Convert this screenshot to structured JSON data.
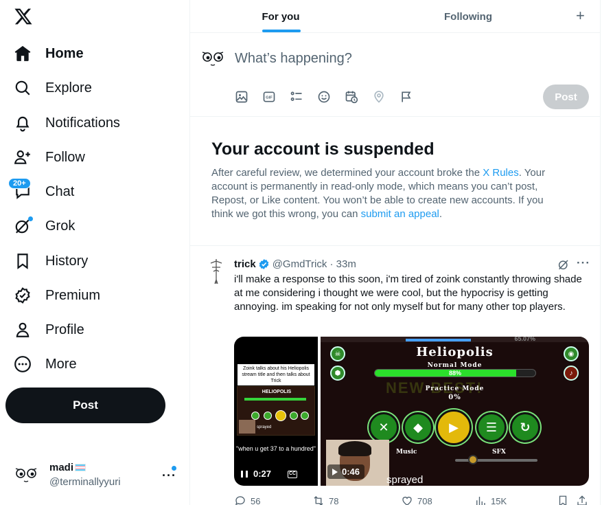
{
  "sidebar": {
    "nav": [
      {
        "label": "Home",
        "icon": "home-icon"
      },
      {
        "label": "Explore",
        "icon": "search-icon"
      },
      {
        "label": "Notifications",
        "icon": "bell-icon"
      },
      {
        "label": "Follow",
        "icon": "follow-icon"
      },
      {
        "label": "Chat",
        "icon": "chat-icon",
        "badge": "20+"
      },
      {
        "label": "Grok",
        "icon": "grok-icon"
      },
      {
        "label": "History",
        "icon": "bookmark-icon"
      },
      {
        "label": "Premium",
        "icon": "premium-icon"
      },
      {
        "label": "Profile",
        "icon": "profile-icon"
      },
      {
        "label": "More",
        "icon": "more-circle-icon"
      }
    ],
    "post_label": "Post",
    "account": {
      "name": "madi",
      "handle": "@terminallyyuri"
    }
  },
  "tabs": [
    {
      "label": "For you"
    },
    {
      "label": "Following"
    }
  ],
  "composer": {
    "placeholder": "What’s happening?",
    "post_label": "Post"
  },
  "suspended": {
    "title": "Your account is suspended",
    "text_1": "After careful review, we determined your account broke the ",
    "link_1": "X Rules",
    "text_2": ". Your account is permanently in read-only mode, which means you can’t post, Repost, or Like content. You won’t be able to create new accounts. If you think we got this wrong, you can ",
    "link_2": "submit an appeal",
    "text_3": "."
  },
  "tweet": {
    "name": "trick",
    "handle_time": "@GmdTrick · 33m",
    "body": "i'll make a response to this soon, i'm tired of zoink constantly throwing shade at me considering i thought we were cool, but the hypocrisy is getting annoying. im speaking for not only myself but for many other top players.",
    "media1": {
      "caption_top": "Zoink talks about his Heliopolis stream title and then talks about Trick",
      "mini_title": "HELIOPOLIS",
      "mini_sprayed": "sprayed",
      "caption_bottom": "\"when u get 37 to a hundred\"",
      "duration": "0:27",
      "cc": "CC"
    },
    "media2": {
      "title": "Heliopolis",
      "normal_mode": "Normal Mode",
      "normal_pct": "88%",
      "practice_mode": "Practice Mode",
      "practice_pct": "0%",
      "music": "Music",
      "sfx": "SFX",
      "top_pct": "65.07%",
      "duration": "0:46",
      "sprayed": "sprayed"
    },
    "stats": {
      "replies": "56",
      "reposts": "78",
      "likes": "708",
      "views": "15K"
    }
  },
  "colors": {
    "accent": "#1d9bf0",
    "text": "#0f1419",
    "muted": "#536471"
  }
}
